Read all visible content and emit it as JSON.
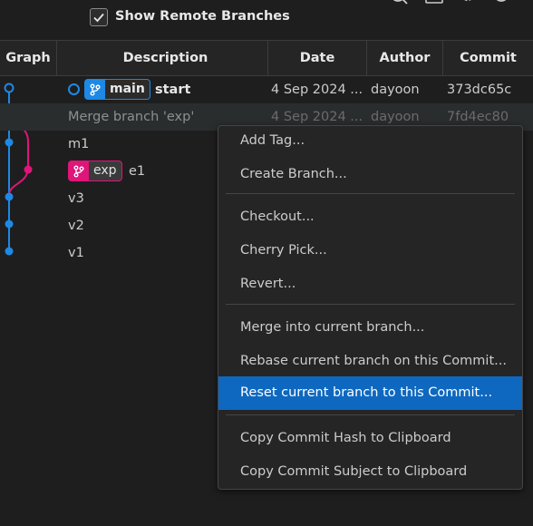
{
  "toolbar": {
    "show_remote_label": "Show Remote Branches",
    "show_remote_checked": true,
    "icons": [
      "search-icon",
      "terminal-icon",
      "gear-icon",
      "refresh-icon"
    ]
  },
  "columns": {
    "graph": "Graph",
    "description": "Description",
    "date": "Date",
    "author": "Author",
    "commit": "Commit"
  },
  "rows": [
    {
      "description": "start",
      "branch": "main",
      "date": "4 Sep 2024 ...",
      "author": "dayoon",
      "commit": "373dc65c"
    },
    {
      "description": "Merge branch 'exp'",
      "date": "4 Sep 2024 ...",
      "author": "dayoon",
      "commit": "7fd4ec80"
    },
    {
      "description": "m1"
    },
    {
      "description": "e1",
      "branch": "exp"
    },
    {
      "description": "v3"
    },
    {
      "description": "v2"
    },
    {
      "description": "v1"
    }
  ],
  "context_menu": {
    "items": [
      "Add Tag...",
      "Create Branch...",
      "Checkout...",
      "Cherry Pick...",
      "Revert...",
      "Merge into current branch...",
      "Rebase current branch on this Commit...",
      "Reset current branch to this Commit...",
      "Copy Commit Hash to Clipboard",
      "Copy Commit Subject to Clipboard"
    ],
    "highlighted": "Reset current branch to this Commit..."
  },
  "colors": {
    "main_branch": "#1e88e5",
    "exp_branch": "#e0157a",
    "menu_highlight": "#0e68c0",
    "background": "#1e1e1e"
  }
}
